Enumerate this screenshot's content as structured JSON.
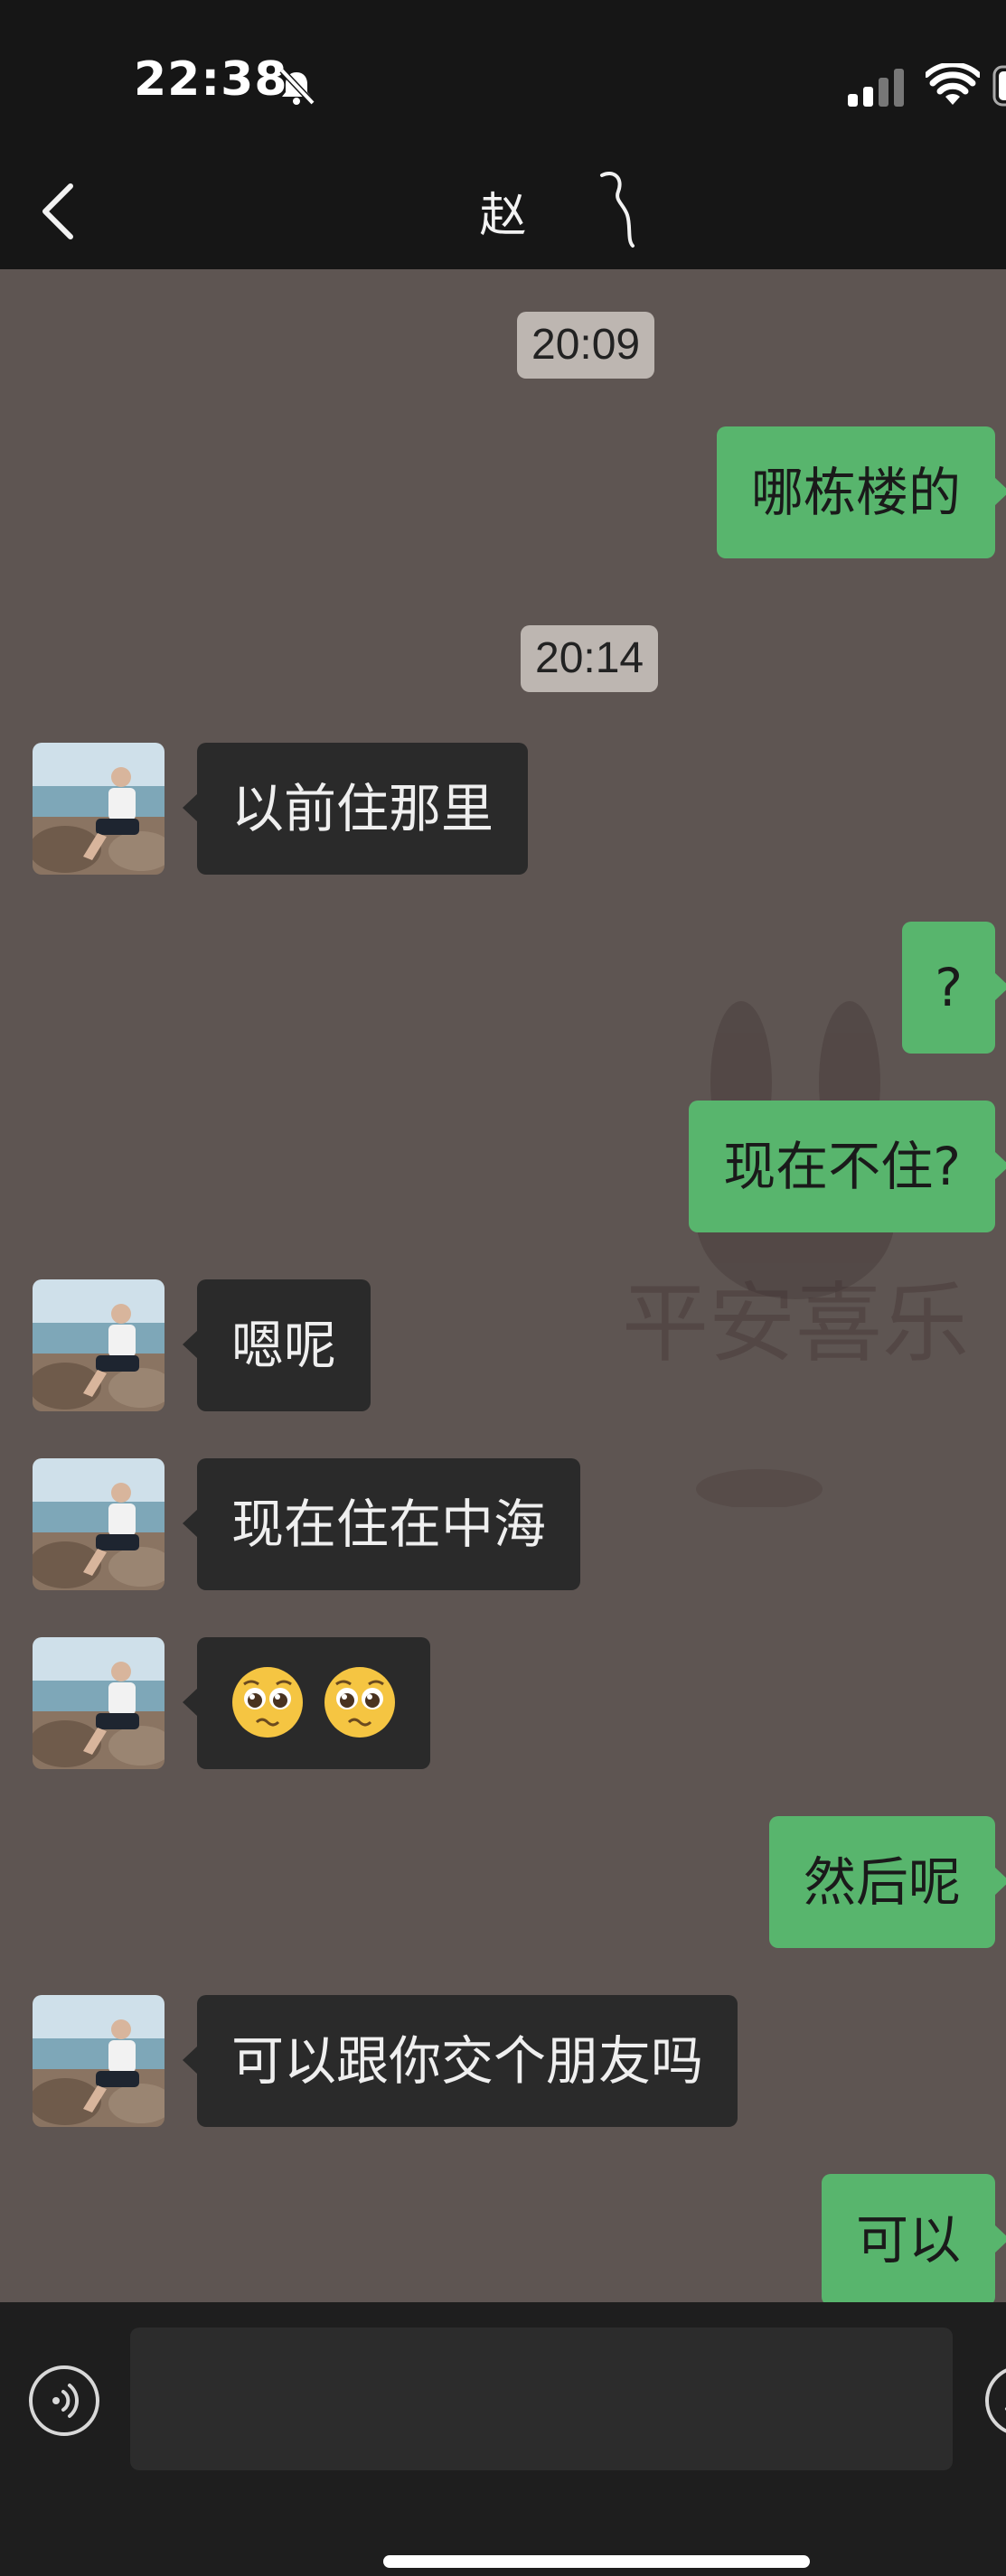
{
  "status_bar": {
    "time": "22:38"
  },
  "nav": {
    "title": "赵"
  },
  "watermark": {
    "text": "平安喜乐"
  },
  "messages": [
    {
      "type": "timestamp",
      "text": "20:09"
    },
    {
      "type": "sent",
      "text": "哪栋楼的"
    },
    {
      "type": "timestamp",
      "text": "20:14"
    },
    {
      "type": "received",
      "text": "以前住那里"
    },
    {
      "type": "sent",
      "text": "?"
    },
    {
      "type": "sent",
      "text": "现在不住?"
    },
    {
      "type": "received",
      "text": "嗯呢"
    },
    {
      "type": "received",
      "text": "现在住在中海"
    },
    {
      "type": "received",
      "emoji": [
        "pleading-face",
        "pleading-face"
      ]
    },
    {
      "type": "sent",
      "text": "然后呢"
    },
    {
      "type": "received",
      "text": "可以跟你交个朋友吗"
    },
    {
      "type": "sent",
      "text": "可以"
    }
  ],
  "colors": {
    "chat_background": "#5e5552",
    "sent_bubble": "#58b56d",
    "received_bubble": "#2a2a2a",
    "timestamp_chip": "#bdb6b1",
    "bar_background": "#161616"
  },
  "icons": {
    "status": [
      "bell-slash-icon",
      "signal-icon",
      "wifi-icon",
      "battery-icon"
    ],
    "nav": [
      "back-chevron-icon"
    ],
    "input": [
      "voice-icon",
      "emoji-icon"
    ]
  }
}
